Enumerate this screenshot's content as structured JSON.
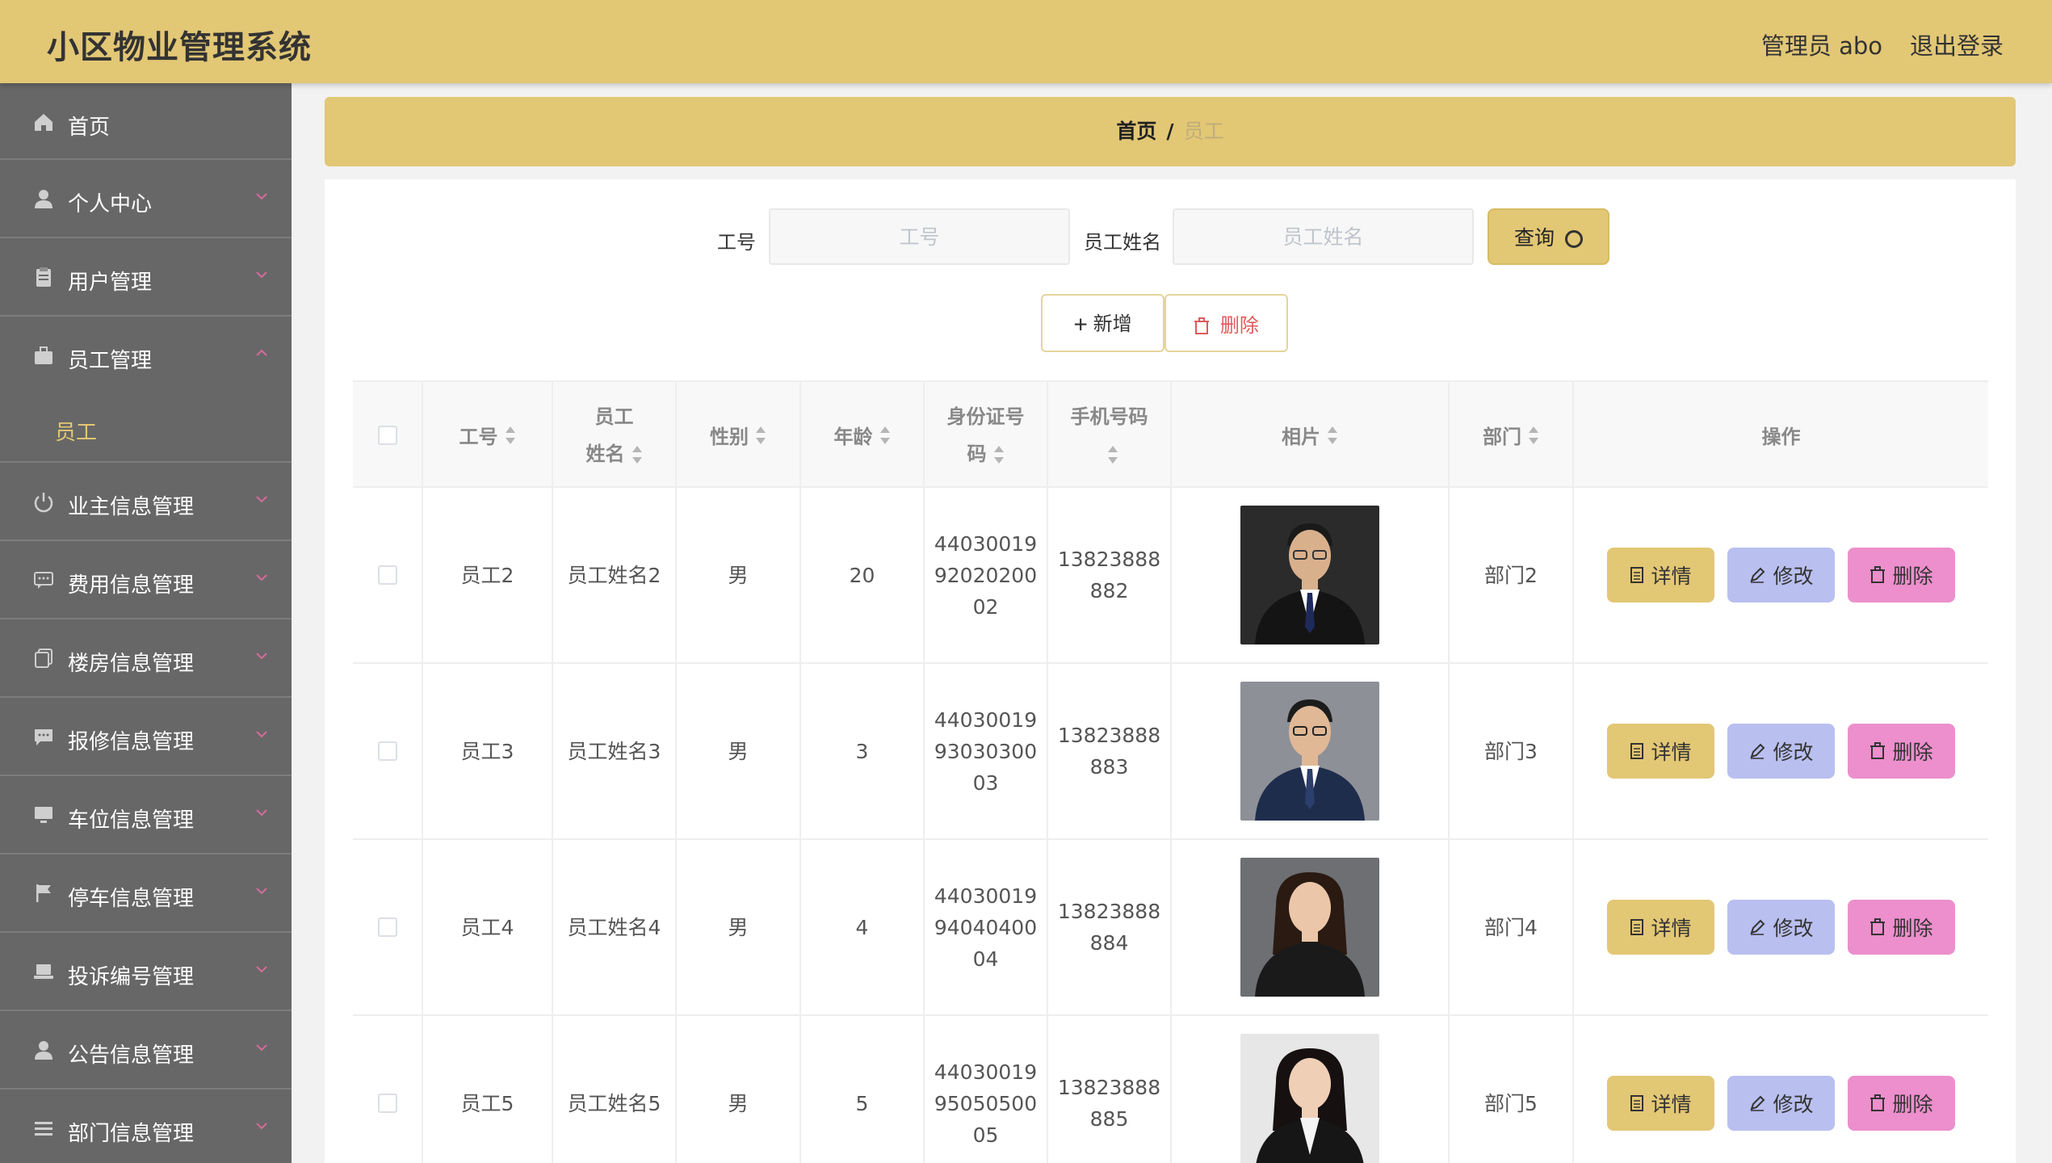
{
  "app": {
    "title": "小区物业管理系统",
    "user_label": "管理员 abo",
    "logout_label": "退出登录"
  },
  "sidebar": {
    "items": [
      {
        "label": "首页",
        "icon": "home-icon"
      },
      {
        "label": "个人中心",
        "icon": "user-icon"
      },
      {
        "label": "用户管理",
        "icon": "clipboard-icon"
      },
      {
        "label": "员工管理",
        "icon": "briefcase-icon",
        "expanded": true,
        "children": [
          "员工"
        ]
      },
      {
        "label": "业主信息管理",
        "icon": "power-icon"
      },
      {
        "label": "费用信息管理",
        "icon": "chat-icon"
      },
      {
        "label": "楼房信息管理",
        "icon": "copy-icon"
      },
      {
        "label": "报修信息管理",
        "icon": "message-icon"
      },
      {
        "label": "车位信息管理",
        "icon": "monitor-icon"
      },
      {
        "label": "停车信息管理",
        "icon": "flag-icon"
      },
      {
        "label": "投诉编号管理",
        "icon": "laptop-icon"
      },
      {
        "label": "公告信息管理",
        "icon": "user-icon"
      },
      {
        "label": "部门信息管理",
        "icon": "list-icon"
      }
    ],
    "submenu": {
      "label": "员工"
    }
  },
  "breadcrumb": {
    "home": "首页",
    "separator": "/",
    "current": "员工"
  },
  "search": {
    "id_label": "工号",
    "id_placeholder": "工号",
    "name_label": "员工姓名",
    "name_placeholder": "员工姓名",
    "query_label": "查询"
  },
  "actions": {
    "add_label": "新增",
    "delete_label": "删除"
  },
  "table": {
    "headers": {
      "id": "工号",
      "name": "员工姓名",
      "gender": "性别",
      "age": "年龄",
      "idcard": "身份证号码",
      "phone": "手机号码",
      "photo": "相片",
      "dept": "部门",
      "ops": "操作"
    },
    "rows": [
      {
        "id": "员工2",
        "name": "员工姓名2",
        "gender": "男",
        "age": "20",
        "idcard": "440300199202020002",
        "phone": "13823888882",
        "dept": "部门2"
      },
      {
        "id": "员工3",
        "name": "员工姓名3",
        "gender": "男",
        "age": "3",
        "idcard": "440300199303030003",
        "phone": "13823888883",
        "dept": "部门3"
      },
      {
        "id": "员工4",
        "name": "员工姓名4",
        "gender": "男",
        "age": "4",
        "idcard": "440300199404040004",
        "phone": "13823888884",
        "dept": "部门4"
      },
      {
        "id": "员工5",
        "name": "员工姓名5",
        "gender": "男",
        "age": "5",
        "idcard": "440300199505050005",
        "phone": "13823888885",
        "dept": "部门5"
      }
    ],
    "op_labels": {
      "detail": "详情",
      "edit": "修改",
      "delete": "删除"
    }
  },
  "colors": {
    "accent": "#e2c775",
    "sidebar_bg": "#676767",
    "edit_button": "#b9bfef",
    "delete_button": "#ec8fcc"
  }
}
